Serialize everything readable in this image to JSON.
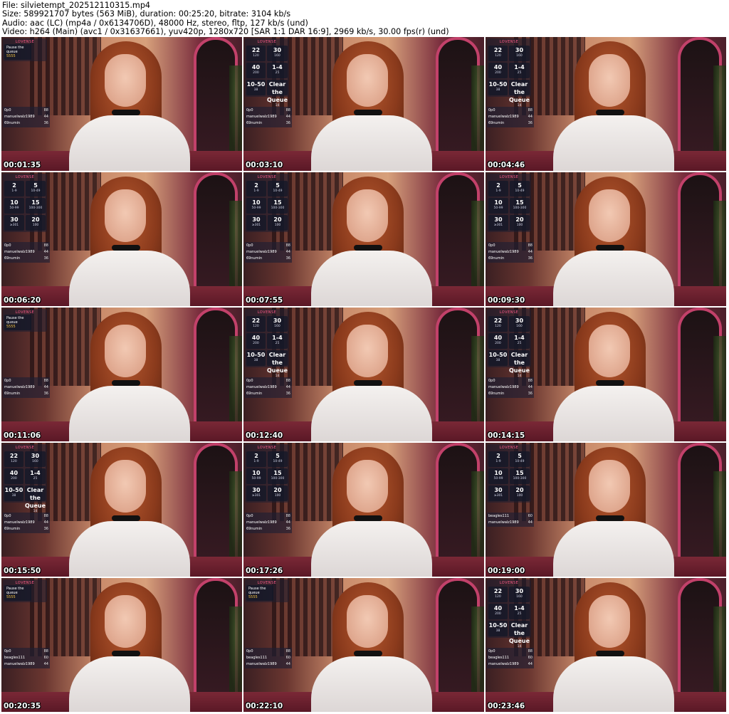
{
  "header": {
    "file_line": "File: silvietempt_202512110315.mp4",
    "size_line": "Size: 589921707 bytes (563 MiB), duration: 00:25:20, bitrate: 3104 kb/s",
    "audio_line": "Audio: aac (LC) (mp4a / 0x6134706D), 48000 Hz, stereo, fltp, 127 kb/s (und)",
    "video_line": "Video: h264 (Main) (avc1 / 0x31637661), yuv420p, 1280x720 [SAR 1:1 DAR 16:9], 2969 kb/s, 30.00 fps(r) (und)"
  },
  "overlay_title": "LOVENSE",
  "pause_panel": {
    "line1": "Pause the",
    "line2": "queue",
    "amount": "5555"
  },
  "tip_menus": {
    "a": [
      {
        "value": "22",
        "sub": "120"
      },
      {
        "value": "30",
        "sub": "160"
      },
      {
        "value": "40",
        "sub": "200"
      },
      {
        "value": "1-4",
        "sub": "25"
      },
      {
        "value": "10-50",
        "sub": "38"
      },
      {
        "value": "Clear the Queue",
        "sub": "14"
      }
    ],
    "b": [
      {
        "value": "2",
        "sub": "1-9"
      },
      {
        "value": "5",
        "sub": "10-49"
      },
      {
        "value": "10",
        "sub": "50-99"
      },
      {
        "value": "15",
        "sub": "100-300"
      },
      {
        "value": "30",
        "sub": "≥301"
      },
      {
        "value": "20",
        "sub": "100"
      }
    ]
  },
  "thumbnails": [
    {
      "time": "00:01:35",
      "panel": "pause",
      "tips": [
        {
          "name": "0p0",
          "amt": "88"
        },
        {
          "name": "manuelwalz1989",
          "amt": "44"
        },
        {
          "name": "69numin",
          "amt": "36"
        }
      ]
    },
    {
      "time": "00:03:10",
      "panel": "a",
      "tips": [
        {
          "name": "0p0",
          "amt": "88"
        },
        {
          "name": "manuelwalz1989",
          "amt": "44"
        },
        {
          "name": "69numin",
          "amt": "36"
        }
      ]
    },
    {
      "time": "00:04:46",
      "panel": "a",
      "tips": [
        {
          "name": "0p0",
          "amt": "88"
        },
        {
          "name": "manuelwalz1989",
          "amt": "44"
        },
        {
          "name": "69numin",
          "amt": "36"
        }
      ]
    },
    {
      "time": "00:06:20",
      "panel": "b",
      "tips": [
        {
          "name": "0p0",
          "amt": "88"
        },
        {
          "name": "manuelwalz1989",
          "amt": "44"
        },
        {
          "name": "69numin",
          "amt": "36"
        }
      ]
    },
    {
      "time": "00:07:55",
      "panel": "b",
      "tips": [
        {
          "name": "0p0",
          "amt": "88"
        },
        {
          "name": "manuelwalz1989",
          "amt": "44"
        },
        {
          "name": "69numin",
          "amt": "36"
        }
      ]
    },
    {
      "time": "00:09:30",
      "panel": "b",
      "tips": [
        {
          "name": "0p0",
          "amt": "88"
        },
        {
          "name": "manuelwalz1989",
          "amt": "44"
        },
        {
          "name": "69numin",
          "amt": "36"
        }
      ]
    },
    {
      "time": "00:11:06",
      "panel": "pause",
      "tips": [
        {
          "name": "0p0",
          "amt": "88"
        },
        {
          "name": "manuelwalz1989",
          "amt": "44"
        },
        {
          "name": "69numin",
          "amt": "36"
        }
      ]
    },
    {
      "time": "00:12:40",
      "panel": "a",
      "tips": [
        {
          "name": "0p0",
          "amt": "88"
        },
        {
          "name": "manuelwalz1989",
          "amt": "44"
        },
        {
          "name": "69numin",
          "amt": "36"
        }
      ]
    },
    {
      "time": "00:14:15",
      "panel": "a",
      "tips": [
        {
          "name": "0p0",
          "amt": "88"
        },
        {
          "name": "manuelwalz1989",
          "amt": "44"
        },
        {
          "name": "69numin",
          "amt": "36"
        }
      ]
    },
    {
      "time": "00:15:50",
      "panel": "a",
      "tips": [
        {
          "name": "0p0",
          "amt": "88"
        },
        {
          "name": "manuelwalz1989",
          "amt": "44"
        },
        {
          "name": "69numin",
          "amt": "36"
        }
      ]
    },
    {
      "time": "00:17:26",
      "panel": "b",
      "tips": [
        {
          "name": "0p0",
          "amt": "88"
        },
        {
          "name": "manuelwalz1989",
          "amt": "44"
        },
        {
          "name": "69numin",
          "amt": "36"
        }
      ]
    },
    {
      "time": "00:19:00",
      "panel": "b",
      "tips": [
        {
          "name": "beagles111",
          "amt": "60"
        },
        {
          "name": "manuelwalz1989",
          "amt": "44"
        }
      ]
    },
    {
      "time": "00:20:35",
      "panel": "pause",
      "tips": [
        {
          "name": "0p0",
          "amt": "88"
        },
        {
          "name": "beagles111",
          "amt": "60"
        },
        {
          "name": "manuelwalz1989",
          "amt": "44"
        }
      ]
    },
    {
      "time": "00:22:10",
      "panel": "pause",
      "tips": [
        {
          "name": "0p0",
          "amt": "88"
        },
        {
          "name": "beagles111",
          "amt": "60"
        },
        {
          "name": "manuelwalz1989",
          "amt": "44"
        }
      ]
    },
    {
      "time": "00:23:46",
      "panel": "a",
      "tips": [
        {
          "name": "0p0",
          "amt": "88"
        },
        {
          "name": "beagles111",
          "amt": "60"
        },
        {
          "name": "manuelwalz1989",
          "amt": "44"
        }
      ]
    }
  ]
}
